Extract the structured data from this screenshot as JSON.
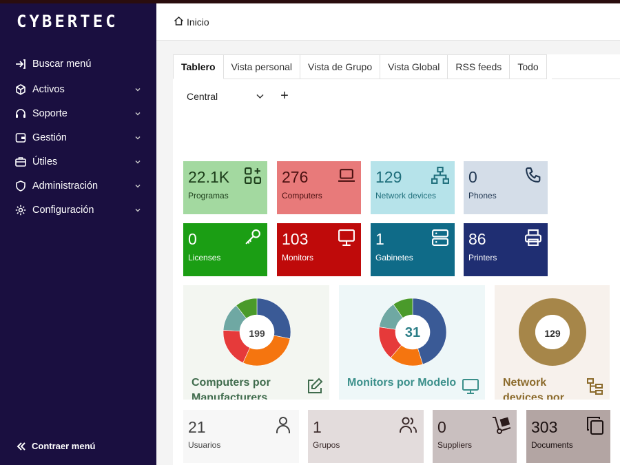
{
  "app": {
    "brand": "CYBERTEC"
  },
  "sidebar": {
    "items": [
      {
        "label": "Buscar menú",
        "icon": "arrow-right-to-bracket-icon",
        "has_chevron": false
      },
      {
        "label": "Activos",
        "icon": "box-icon",
        "has_chevron": true
      },
      {
        "label": "Soporte",
        "icon": "headset-icon",
        "has_chevron": true
      },
      {
        "label": "Gestión",
        "icon": "wallet-icon",
        "has_chevron": true
      },
      {
        "label": "Útiles",
        "icon": "briefcase-icon",
        "has_chevron": true
      },
      {
        "label": "Administración",
        "icon": "shield-icon",
        "has_chevron": true
      },
      {
        "label": "Configuración",
        "icon": "gear-icon",
        "has_chevron": true
      }
    ],
    "collapse_label": "Contraer menú"
  },
  "header": {
    "breadcrumb": "Inicio"
  },
  "tabs": [
    {
      "label": "Tablero",
      "active": true
    },
    {
      "label": "Vista personal"
    },
    {
      "label": "Vista de Grupo"
    },
    {
      "label": "Vista Global"
    },
    {
      "label": "RSS feeds"
    },
    {
      "label": "Todo"
    }
  ],
  "dashboard_select": {
    "value": "Central"
  },
  "add_label": "+",
  "tiles": [
    {
      "value": "22.1K",
      "label": "Programas",
      "bg": "#a3d9a0",
      "fg": "#1c3d1a",
      "icon": "apps-add-icon"
    },
    {
      "value": "276",
      "label": "Computers",
      "bg": "#e87a7a",
      "fg": "#4a1010",
      "icon": "laptop-icon"
    },
    {
      "value": "129",
      "label": "Network devices",
      "bg": "#b6e3ea",
      "fg": "#1f6f7c",
      "icon": "network-icon"
    },
    {
      "value": "0",
      "label": "Phones",
      "bg": "#d4dde8",
      "fg": "#1f3550",
      "icon": "phone-icon"
    },
    {
      "value": "0",
      "label": "Licenses",
      "bg": "#1b9e14",
      "fg": "#ffffff",
      "icon": "key-icon"
    },
    {
      "value": "103",
      "label": "Monitors",
      "bg": "#bf0a0a",
      "fg": "#ffffff",
      "icon": "monitor-icon"
    },
    {
      "value": "1",
      "label": "Gabinetes",
      "bg": "#0f6b88",
      "fg": "#ffffff",
      "icon": "server-icon"
    },
    {
      "value": "86",
      "label": "Printers",
      "bg": "#1f2e72",
      "fg": "#ffffff",
      "icon": "printer-icon"
    }
  ],
  "chart_data": [
    {
      "type": "pie",
      "title": "Computers por Manufacturers",
      "center_label": "199",
      "slices": [
        {
          "value": 56,
          "color": "#3a5a96"
        },
        {
          "value": 57,
          "color": "#f5750f"
        },
        {
          "value": 38,
          "color": "#e63a3a"
        },
        {
          "value": 27,
          "color": "#6fa8a3"
        },
        {
          "value": 21,
          "color": "#4a9a2a"
        }
      ]
    },
    {
      "type": "pie",
      "title": "Monitors por Modelo",
      "center_label": "31",
      "slices": [
        {
          "value": 14,
          "color": "#3a5a96"
        },
        {
          "value": 5,
          "color": "#f5750f"
        },
        {
          "value": 5,
          "color": "#e63a3a"
        },
        {
          "value": 4,
          "color": "#6fa8a3"
        },
        {
          "value": 3,
          "color": "#4a9a2a"
        }
      ]
    },
    {
      "type": "pie",
      "title": "Network devices por",
      "center_label": "129",
      "slices": [
        {
          "value": 129,
          "color": "#a68649"
        }
      ]
    }
  ],
  "chart_cards": [
    {
      "bg": "#f3f6f1",
      "title_color": "#3f6b4c",
      "num_color": "#444444",
      "icon": "pen-to-square-icon"
    },
    {
      "bg": "#eef7f8",
      "title_color": "#3a8f8a",
      "num_color": "#2d7f88",
      "icon": "desktop-icon"
    },
    {
      "bg": "#f7f1ec",
      "title_color": "#8b6a2b",
      "num_color": "#333333",
      "icon": "sitemap-icon"
    }
  ],
  "bottom_tiles": [
    {
      "value": "21",
      "label": "Usuarios",
      "bg": "#f7f7f7",
      "fg": "#444444",
      "icon": "user-icon"
    },
    {
      "value": "1",
      "label": "Grupos",
      "bg": "#e3dcdc",
      "fg": "#3a2a2a",
      "icon": "users-icon"
    },
    {
      "value": "0",
      "label": "Suppliers",
      "bg": "#c9bfbf",
      "fg": "#2a1a1a",
      "icon": "dolly-icon"
    },
    {
      "value": "303",
      "label": "Documents",
      "bg": "#b3a5a3",
      "fg": "#1a1010",
      "icon": "copy-icon"
    }
  ]
}
